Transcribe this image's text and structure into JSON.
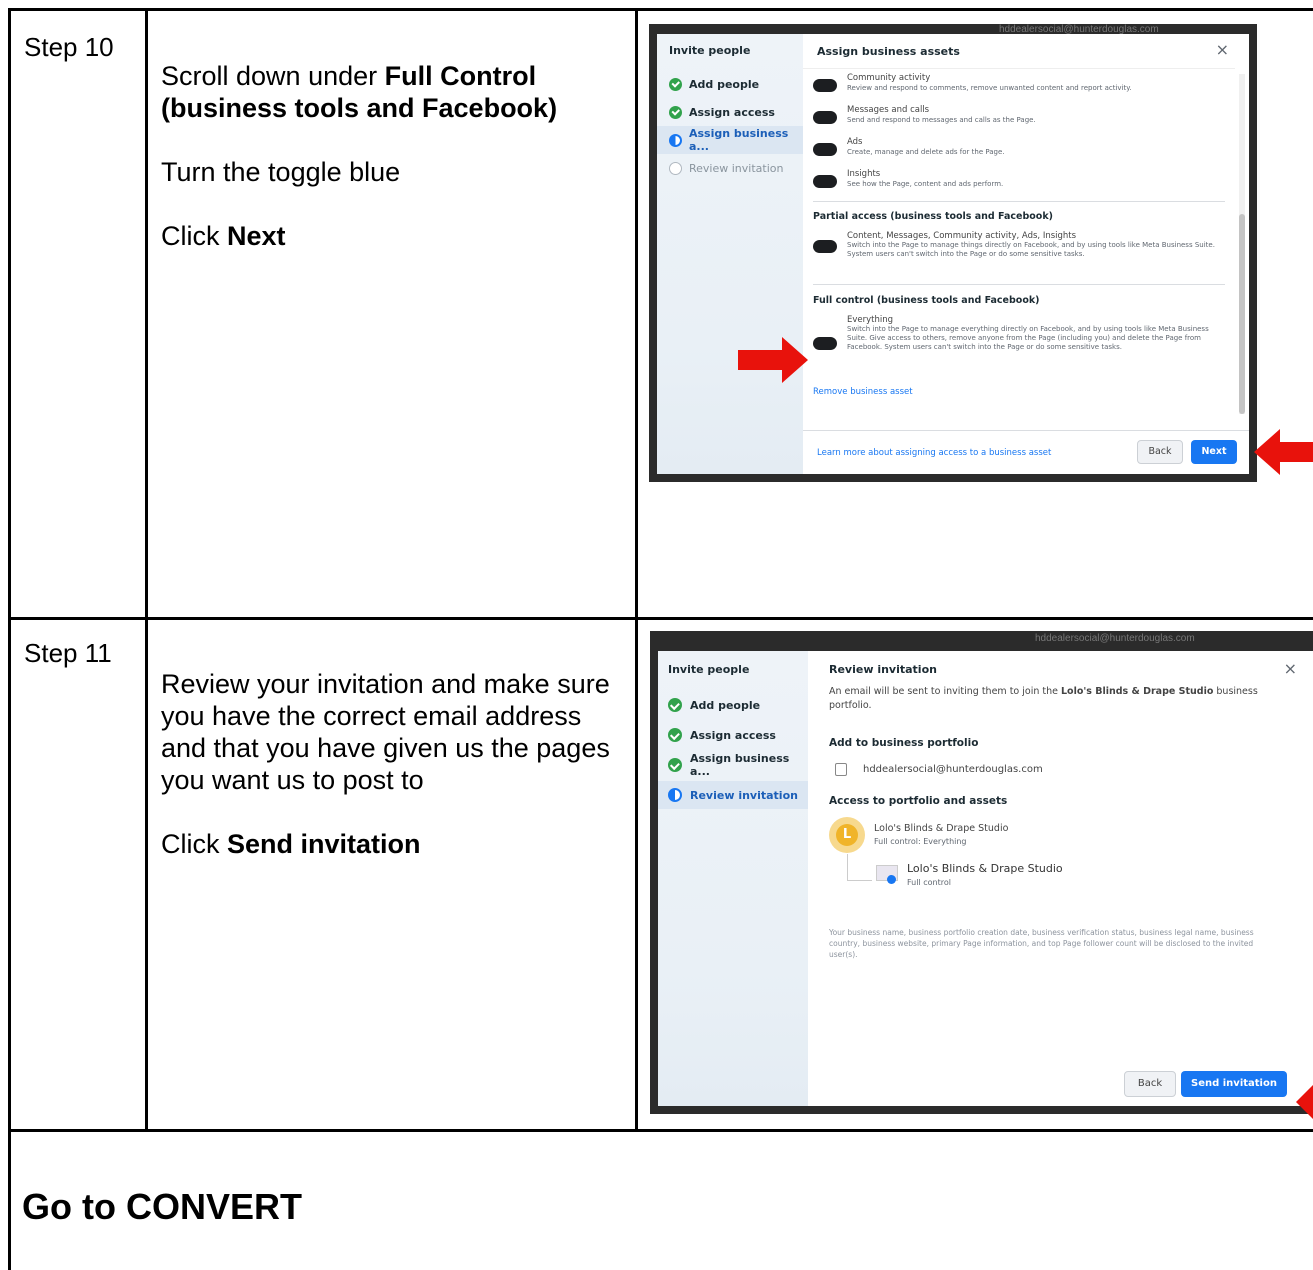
{
  "steps": [
    {
      "label": "Step 10",
      "instructions": {
        "line1_plain": "Scroll down under ",
        "line1_bold": "Full Control (business tools and Facebook)",
        "line2": "Turn the toggle blue",
        "line3_plain": "Click ",
        "line3_bold": "Next"
      },
      "screenshot": {
        "search_text": "hddealersocial@hunterdouglas.com",
        "sidebar_title": "Invite people",
        "sidebar_steps": [
          "Add people",
          "Assign access",
          "Assign business a...",
          "Review invitation"
        ],
        "header": "Assign business assets",
        "close_icon": "×",
        "permissions": [
          {
            "title": "Community activity",
            "desc": "Review and respond to comments, remove unwanted content and report activity."
          },
          {
            "title": "Messages and calls",
            "desc": "Send and respond to messages and calls as the Page."
          },
          {
            "title": "Ads",
            "desc": "Create, manage and delete ads for the Page."
          },
          {
            "title": "Insights",
            "desc": "See how the Page, content and ads perform."
          }
        ],
        "partial_heading": "Partial access (business tools and Facebook)",
        "partial_item": {
          "title": "Content, Messages, Community activity, Ads, Insights",
          "desc": "Switch into the Page to manage things directly on Facebook, and by using tools like Meta Business Suite. System users can't switch into the Page or do some sensitive tasks."
        },
        "full_heading": "Full control (business tools and Facebook)",
        "full_item": {
          "title": "Everything",
          "desc": "Switch into the Page to manage everything directly on Facebook, and by using tools like Meta Business Suite. Give access to others, remove anyone from the Page (including you) and delete the Page from Facebook. System users can't switch into the Page or do some sensitive tasks."
        },
        "remove_link": "Remove business asset",
        "learn_link": "Learn more about assigning access to a business asset",
        "back_label": "Back",
        "next_label": "Next"
      }
    },
    {
      "label": "Step 11",
      "instructions": {
        "para1": "Review your invitation and make sure you have the correct email address and that you have given us the pages you want us to post to",
        "line3_plain": "Click ",
        "line3_bold": "Send invitation"
      },
      "screenshot": {
        "search_text": "hddealersocial@hunterdouglas.com",
        "sidebar_title": "Invite people",
        "sidebar_steps": [
          "Add people",
          "Assign access",
          "Assign business a...",
          "Review invitation"
        ],
        "header": "Review invitation",
        "close_icon": "×",
        "intro_plain_1": "An email will be sent to inviting them to join the ",
        "intro_bold": "Lolo's Blinds & Drape Studio",
        "intro_plain_2": " business portfolio.",
        "add_heading": "Add to business portfolio",
        "email": "hddealersocial@hunterdouglas.com",
        "access_heading": "Access to portfolio and assets",
        "portfolio_initial": "L",
        "portfolio_name": "Lolo's Blinds & Drape Studio",
        "portfolio_access": "Full control: Everything",
        "page_name": "Lolo's Blinds & Drape Studio",
        "page_access": "Full control",
        "disclosure": "Your business name, business portfolio creation date, business verification status, business legal name, business country, business website, primary Page information, and top Page follower count will be disclosed to the invited user(s).",
        "back_label": "Back",
        "send_label": "Send invitation"
      }
    }
  ],
  "footer": {
    "heading": "Go to CONVERT"
  },
  "colors": {
    "arrow": "#e8120c",
    "primary_blue": "#1877f2",
    "check_green": "#31a24c"
  }
}
